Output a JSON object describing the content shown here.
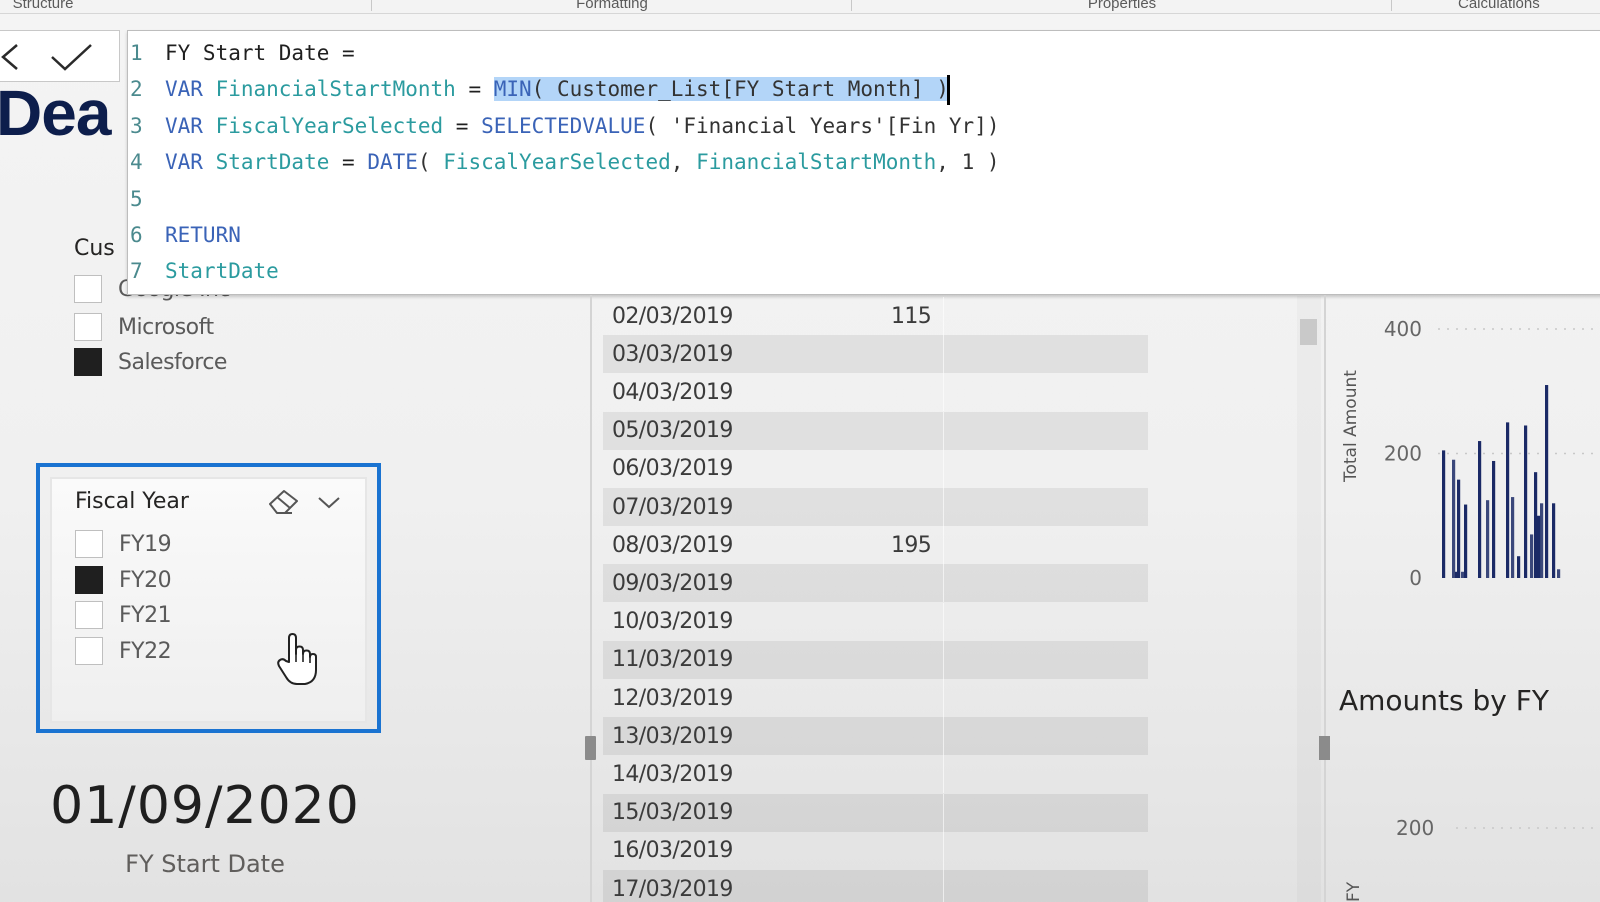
{
  "ribbon": {
    "groups": [
      "Structure",
      "Formatting",
      "Properties",
      "Calculations"
    ]
  },
  "formula_bar": {
    "cancel_icon": "close-icon",
    "commit_icon": "checkmark-icon",
    "lines": [
      {
        "n": "1",
        "tokens": [
          {
            "t": "FY Start Date =",
            "c": "plain"
          }
        ]
      },
      {
        "n": "2",
        "tokens": [
          {
            "t": "VAR ",
            "c": "kw"
          },
          {
            "t": "FinancialStartMonth",
            "c": "var"
          },
          {
            "t": " = ",
            "c": "plain"
          },
          {
            "t": "MIN",
            "c": "fn",
            "sel": true
          },
          {
            "t": "( Customer_List[FY Start Month] )",
            "c": "str",
            "sel": true
          }
        ],
        "caret": true
      },
      {
        "n": "3",
        "tokens": [
          {
            "t": "VAR ",
            "c": "kw"
          },
          {
            "t": "FiscalYearSelected",
            "c": "var"
          },
          {
            "t": " = ",
            "c": "plain"
          },
          {
            "t": "SELECTEDVALUE",
            "c": "fn"
          },
          {
            "t": "( 'Financial Years'[Fin Yr])",
            "c": "str"
          }
        ]
      },
      {
        "n": "4",
        "tokens": [
          {
            "t": "VAR ",
            "c": "kw"
          },
          {
            "t": "StartDate",
            "c": "var"
          },
          {
            "t": " = ",
            "c": "plain"
          },
          {
            "t": "DATE",
            "c": "fn"
          },
          {
            "t": "( ",
            "c": "str"
          },
          {
            "t": "FiscalYearSelected",
            "c": "var"
          },
          {
            "t": ", ",
            "c": "str"
          },
          {
            "t": "FinancialStartMonth",
            "c": "var"
          },
          {
            "t": ", 1 )",
            "c": "str"
          }
        ]
      },
      {
        "n": "5",
        "tokens": []
      },
      {
        "n": "6",
        "tokens": [
          {
            "t": "RETURN",
            "c": "kw"
          }
        ]
      },
      {
        "n": "7",
        "tokens": [
          {
            "t": "StartDate",
            "c": "var"
          }
        ]
      }
    ]
  },
  "page": {
    "title_fragment": "Dea"
  },
  "customer_slicer": {
    "title_fragment": "Cus",
    "items": [
      {
        "label": "Google Inc",
        "checked": false
      },
      {
        "label": "Microsoft",
        "checked": false
      },
      {
        "label": "Salesforce",
        "checked": true
      }
    ]
  },
  "fiscal_year_slicer": {
    "title": "Fiscal Year",
    "eraser_icon": "eraser-icon",
    "chevron_icon": "chevron-down-icon",
    "items": [
      {
        "label": "FY19",
        "checked": false
      },
      {
        "label": "FY20",
        "checked": true
      },
      {
        "label": "FY21",
        "checked": false
      },
      {
        "label": "FY22",
        "checked": false
      }
    ]
  },
  "card": {
    "value": "01/09/2020",
    "label": "FY Start Date"
  },
  "table": {
    "rows": [
      {
        "date": "02/03/2019",
        "amount": "115"
      },
      {
        "date": "03/03/2019",
        "amount": ""
      },
      {
        "date": "04/03/2019",
        "amount": ""
      },
      {
        "date": "05/03/2019",
        "amount": ""
      },
      {
        "date": "06/03/2019",
        "amount": ""
      },
      {
        "date": "07/03/2019",
        "amount": ""
      },
      {
        "date": "08/03/2019",
        "amount": "195"
      },
      {
        "date": "09/03/2019",
        "amount": ""
      },
      {
        "date": "10/03/2019",
        "amount": ""
      },
      {
        "date": "11/03/2019",
        "amount": ""
      },
      {
        "date": "12/03/2019",
        "amount": ""
      },
      {
        "date": "13/03/2019",
        "amount": ""
      },
      {
        "date": "14/03/2019",
        "amount": ""
      },
      {
        "date": "15/03/2019",
        "amount": ""
      },
      {
        "date": "16/03/2019",
        "amount": ""
      },
      {
        "date": "17/03/2019",
        "amount": ""
      }
    ]
  },
  "chart_data": [
    {
      "type": "bar",
      "title": "",
      "xlabel": "",
      "ylabel": "Total Amount",
      "ylim": [
        0,
        400
      ],
      "yticks": [
        "0",
        "200",
        "400"
      ],
      "grid": true,
      "color": "#1b2a66",
      "values": [
        205,
        190,
        158,
        10,
        10,
        118,
        220,
        125,
        188,
        250,
        130,
        35,
        245,
        70,
        170,
        100,
        120,
        310,
        120,
        14
      ]
    },
    {
      "type": "bar",
      "title": "Amounts by FY",
      "ylabel": "FY",
      "yticks": [
        "200"
      ],
      "grid": true
    }
  ]
}
